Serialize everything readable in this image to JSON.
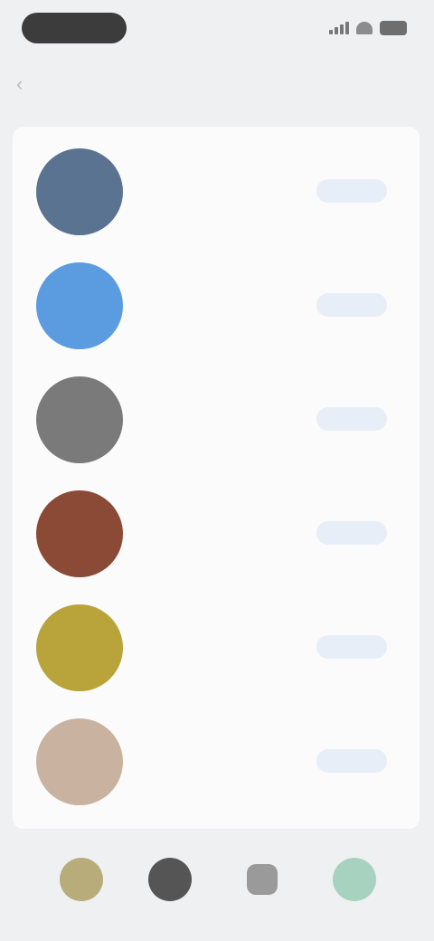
{
  "status_bar": {
    "icons": [
      "signal-icon",
      "wifi-icon",
      "battery-icon"
    ]
  },
  "header": {
    "title": "",
    "back_icon": "chevron-left-icon"
  },
  "list": {
    "items": [
      {
        "title": "",
        "subtitle": "",
        "action": "",
        "avatar_color": "#5a7391"
      },
      {
        "title": "",
        "subtitle": "",
        "action": "",
        "avatar_color": "#5b9be0"
      },
      {
        "title": "",
        "subtitle": "",
        "action": "",
        "avatar_color": "#7a7a7a"
      },
      {
        "title": "",
        "subtitle": "",
        "action": "",
        "avatar_color": "#8a4a35"
      },
      {
        "title": "",
        "subtitle": "",
        "action": "",
        "avatar_color": "#b8a43a"
      },
      {
        "title": "",
        "subtitle": "",
        "action": "",
        "avatar_color": "#c9b2a0"
      }
    ]
  },
  "tab_bar": {
    "tabs": [
      {
        "icon": "home-icon",
        "color": "#b8ac7a"
      },
      {
        "icon": "profile-icon",
        "color": "#555555"
      },
      {
        "icon": "bell-icon",
        "color": "#9a9a9a"
      },
      {
        "icon": "settings-icon",
        "color": "#a7d2bf"
      }
    ]
  },
  "colors": {
    "background": "#eef0f2",
    "card": "#fbfbfb",
    "accent": "#5b8fd6"
  }
}
